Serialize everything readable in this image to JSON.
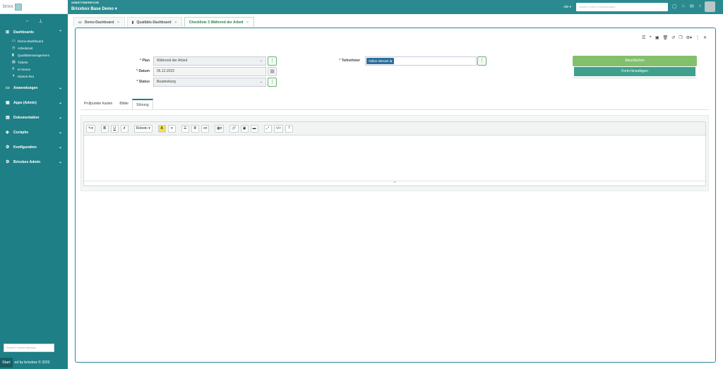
{
  "app": {
    "logo": "brixx"
  },
  "sidebar": {
    "back_icon": "←",
    "pin_icon": "📌",
    "groups": [
      {
        "label": "Dashboards",
        "icon": "⊞",
        "expanded": true
      },
      {
        "label": "Anwendungen",
        "icon": "▭"
      },
      {
        "label": "Apps (Admin)",
        "icon": "▣"
      },
      {
        "label": "Dokumentation",
        "icon": "▤"
      },
      {
        "label": "Cockpits",
        "icon": "◈"
      },
      {
        "label": "Konfiguration",
        "icon": "⚙"
      },
      {
        "label": "Brixxbox Admin",
        "icon": "⚙"
      }
    ],
    "dashboard_items": [
      {
        "label": "Demo-Dashboard",
        "icon": "▭"
      },
      {
        "label": "Arbeitszeit",
        "icon": "◷"
      },
      {
        "label": "Qualitätsmanagement",
        "icon": "▮"
      },
      {
        "label": "Tickets",
        "icon": "▤"
      },
      {
        "label": "KI-Demo",
        "icon": "⚲"
      },
      {
        "label": "Klamm-Rot",
        "icon": "⚘"
      }
    ],
    "search_placeholder": "Suche in Anwendungen",
    "footer_text": "ed by brixxbox © 2023",
    "start_label": "Start"
  },
  "topbar": {
    "workspace_label": "ARBEITSBEREICHE",
    "workspace_name": "Brixxbox Base Demo ▾",
    "filter_label": "Alle ▾",
    "search_placeholder": "Suche in allen Anwendungen"
  },
  "tabs": [
    {
      "label": "Demo-Dashboard",
      "icon": "▭",
      "active": false
    },
    {
      "label": "Qualitäts-Dashboard",
      "icon": "▮",
      "active": false
    },
    {
      "label": "Checkliste 3 Während der Arbeit",
      "icon": "",
      "active": true
    }
  ],
  "form": {
    "plan_label": "Plan",
    "plan_value": "Während der Arbeit",
    "datum_label": "Datum",
    "datum_value": "05.12.2022",
    "status_label": "Status",
    "status_value": "Bearbeitung",
    "teilnehmer_label": "Teilnehmer",
    "teilnehmer_chip": "Volker Wessel"
  },
  "actions": {
    "primary_label": "Abschließen",
    "secondary_label": "Form hinzufügen"
  },
  "subtabs": [
    {
      "label": "Prüfpunkte Karten",
      "active": false
    },
    {
      "label": "Bilder",
      "active": false
    },
    {
      "label": "Störung",
      "active": true
    }
  ],
  "editor": {
    "font_name": "Roboto ▾",
    "buttons": [
      "✎▾",
      "B",
      "U",
      "✗",
      "A",
      "▾",
      "☰",
      "≣",
      "≡▾",
      "▦▾",
      "🔗",
      "▣",
      "▬",
      "⤢",
      "</>",
      "?"
    ]
  }
}
